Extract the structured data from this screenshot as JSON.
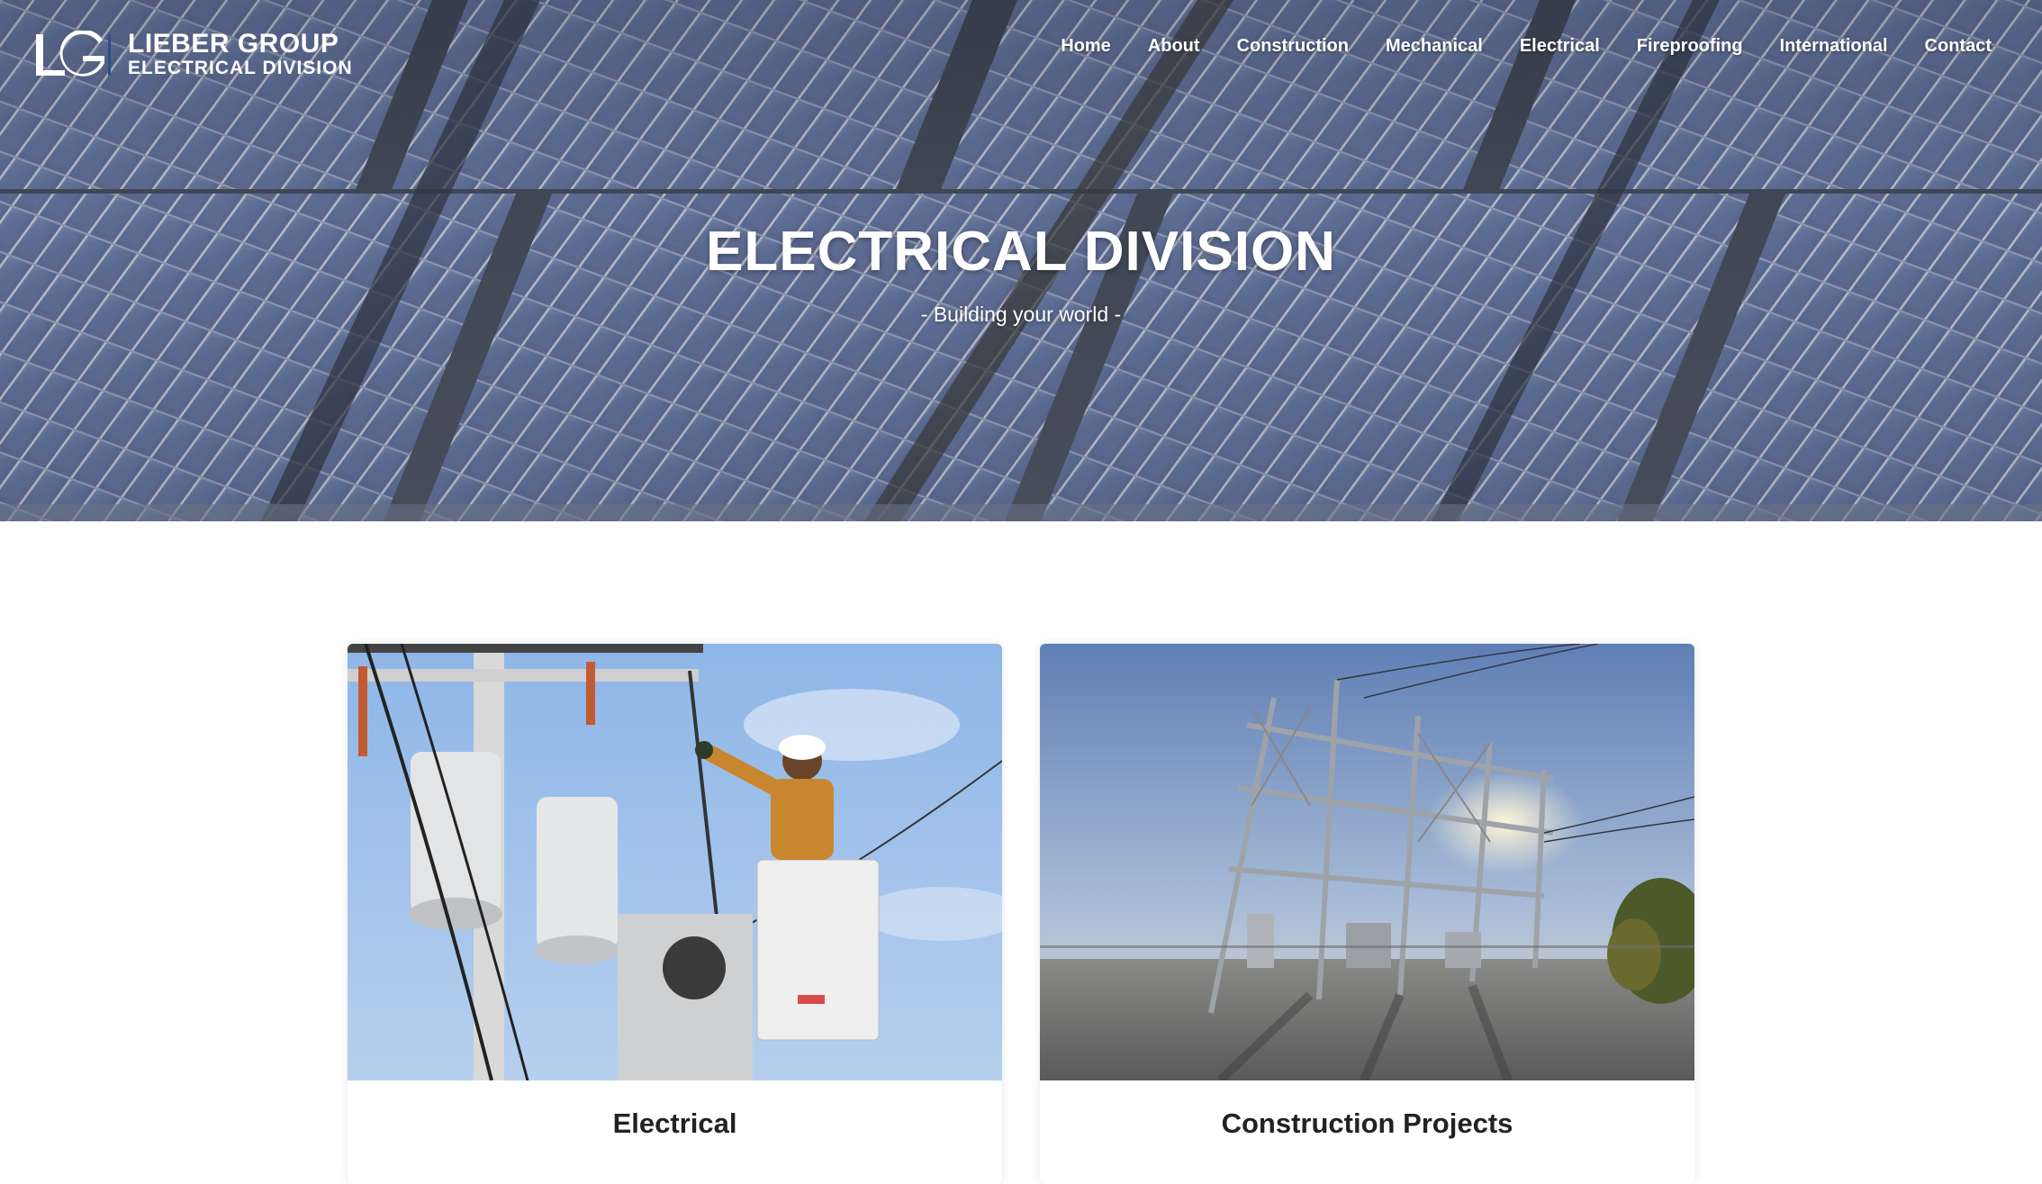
{
  "brand": {
    "mark": "LG",
    "name_line1": "LIEBER GROUP",
    "name_line2": "ELECTRICAL DIVISION"
  },
  "nav": {
    "items": [
      {
        "label": "Home"
      },
      {
        "label": "About"
      },
      {
        "label": "Construction"
      },
      {
        "label": "Mechanical"
      },
      {
        "label": "Electrical"
      },
      {
        "label": "Fireproofing"
      },
      {
        "label": "International"
      },
      {
        "label": "Contact"
      }
    ]
  },
  "hero": {
    "title": "ELECTRICAL DIVISION",
    "subtitle": "- Building your world -",
    "background_image": "solar-panel-field"
  },
  "cards": [
    {
      "title": "Electrical",
      "image": "lineman-on-utility-pole"
    },
    {
      "title": "Construction Projects",
      "image": "electrical-substation"
    }
  ],
  "colors": {
    "text_dark": "#222222",
    "logo_accent": "#1f3f7a",
    "white": "#ffffff"
  }
}
